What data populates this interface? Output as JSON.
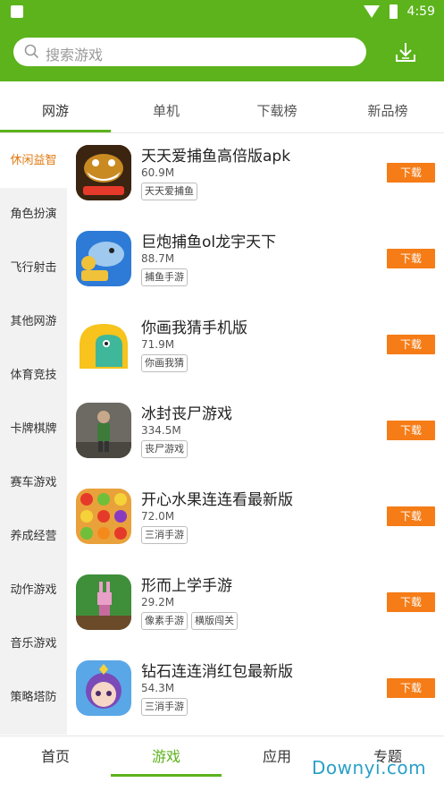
{
  "status_bar": {
    "time": "4:59"
  },
  "search": {
    "placeholder": "搜索游戏"
  },
  "tabs": [
    {
      "label": "网游",
      "active": true
    },
    {
      "label": "单机",
      "active": false
    },
    {
      "label": "下载榜",
      "active": false
    },
    {
      "label": "新品榜",
      "active": false
    }
  ],
  "sidebar": [
    {
      "label": "休闲益智",
      "active": true
    },
    {
      "label": "角色扮演",
      "active": false
    },
    {
      "label": "飞行射击",
      "active": false
    },
    {
      "label": "其他网游",
      "active": false
    },
    {
      "label": "体育竞技",
      "active": false
    },
    {
      "label": "卡牌棋牌",
      "active": false
    },
    {
      "label": "赛车游戏",
      "active": false
    },
    {
      "label": "养成经营",
      "active": false
    },
    {
      "label": "动作游戏",
      "active": false
    },
    {
      "label": "音乐游戏",
      "active": false
    },
    {
      "label": "策略塔防",
      "active": false
    }
  ],
  "apps": [
    {
      "name": "天天爱捕鱼高倍版apk",
      "size": "60.9M",
      "tags": [
        "天天爱捕鱼"
      ],
      "button": "下载",
      "icon": "fish-game-icon",
      "icon_color": "#3b2410"
    },
    {
      "name": "巨炮捕鱼ol龙宇天下",
      "size": "88.7M",
      "tags": [
        "捕鱼手游"
      ],
      "button": "下载",
      "icon": "shark-game-icon",
      "icon_color": "#2d7bd6"
    },
    {
      "name": "你画我猜手机版",
      "size": "71.9M",
      "tags": [
        "你画我猜"
      ],
      "button": "下载",
      "icon": "draw-guess-icon",
      "icon_color": "#f7c31c"
    },
    {
      "name": "冰封丧尸游戏",
      "size": "334.5M",
      "tags": [
        "丧尸游戏"
      ],
      "button": "下载",
      "icon": "zombie-game-icon",
      "icon_color": "#6d6a63"
    },
    {
      "name": "开心水果连连看最新版",
      "size": "72.0M",
      "tags": [
        "三消手游"
      ],
      "button": "下载",
      "icon": "fruit-match-icon",
      "icon_color": "#e9a23b"
    },
    {
      "name": "形而上学手游",
      "size": "29.2M",
      "tags": [
        "像素手游",
        "横版闯关"
      ],
      "button": "下载",
      "icon": "pixel-rabbit-icon",
      "icon_color": "#3f8f3a"
    },
    {
      "name": "钻石连连消红包最新版",
      "size": "54.3M",
      "tags": [
        "三消手游"
      ],
      "button": "下载",
      "icon": "diamond-girl-icon",
      "icon_color": "#5aa7e8"
    }
  ],
  "bottom_nav": [
    {
      "label": "首页",
      "active": false
    },
    {
      "label": "游戏",
      "active": true
    },
    {
      "label": "应用",
      "active": false
    },
    {
      "label": "专题",
      "active": false
    }
  ],
  "watermark": "Downyi.com",
  "colors": {
    "brand_green": "#5cb31c",
    "download_orange": "#f57c16",
    "active_side": "#e07a12"
  }
}
